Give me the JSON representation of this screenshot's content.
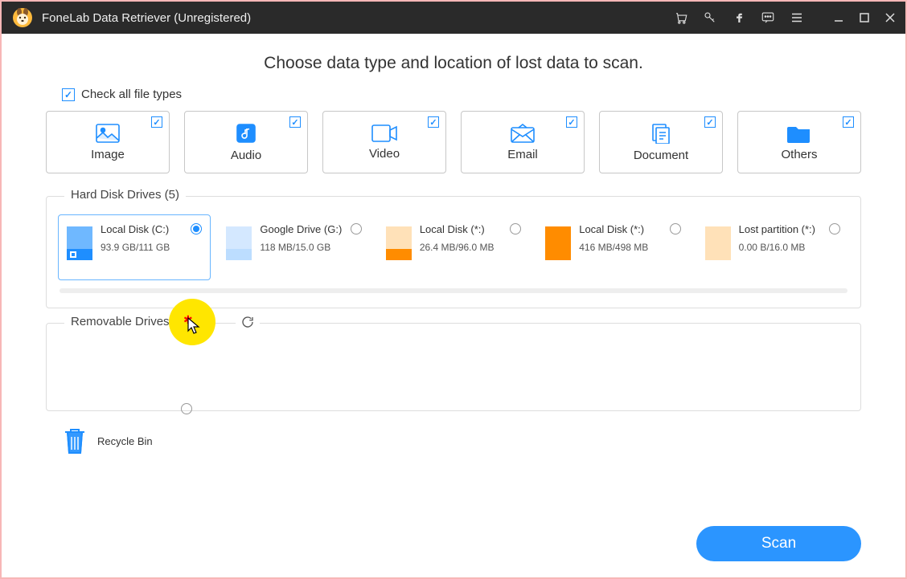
{
  "titlebar": {
    "title": "FoneLab Data Retriever (Unregistered)"
  },
  "heading": "Choose data type and location of lost data to scan.",
  "check_all_label": "Check all file types",
  "types": [
    {
      "label": "Image"
    },
    {
      "label": "Audio"
    },
    {
      "label": "Video"
    },
    {
      "label": "Email"
    },
    {
      "label": "Document"
    },
    {
      "label": "Others"
    }
  ],
  "hdd_group_label": "Hard Disk Drives (5)",
  "drives": [
    {
      "name": "Local Disk (C:)",
      "size": "93.9 GB/111 GB",
      "color_top": "#6fb8ff",
      "color_bottom": "#1e8eff",
      "selected": true
    },
    {
      "name": "Google Drive (G:)",
      "size": "118 MB/15.0 GB",
      "color_top": "#d4e8ff",
      "color_bottom": "#bcddff",
      "selected": false
    },
    {
      "name": "Local Disk (*:)",
      "size": "26.4 MB/96.0 MB",
      "color_top": "#ffe1b8",
      "color_bottom": "#ff8c00",
      "selected": false
    },
    {
      "name": "Local Disk (*:)",
      "size": "416 MB/498 MB",
      "color_top": "#ff8c00",
      "color_bottom": "#ff8c00",
      "selected": false
    },
    {
      "name": "Lost partition (*:)",
      "size": "0.00  B/16.0 MB",
      "color_top": "#ffe1b8",
      "color_bottom": "#ffe1b8",
      "selected": false
    }
  ],
  "removable_group_label": "Removable Drives (0)",
  "recycle_label": "Recycle Bin",
  "scan_label": "Scan"
}
